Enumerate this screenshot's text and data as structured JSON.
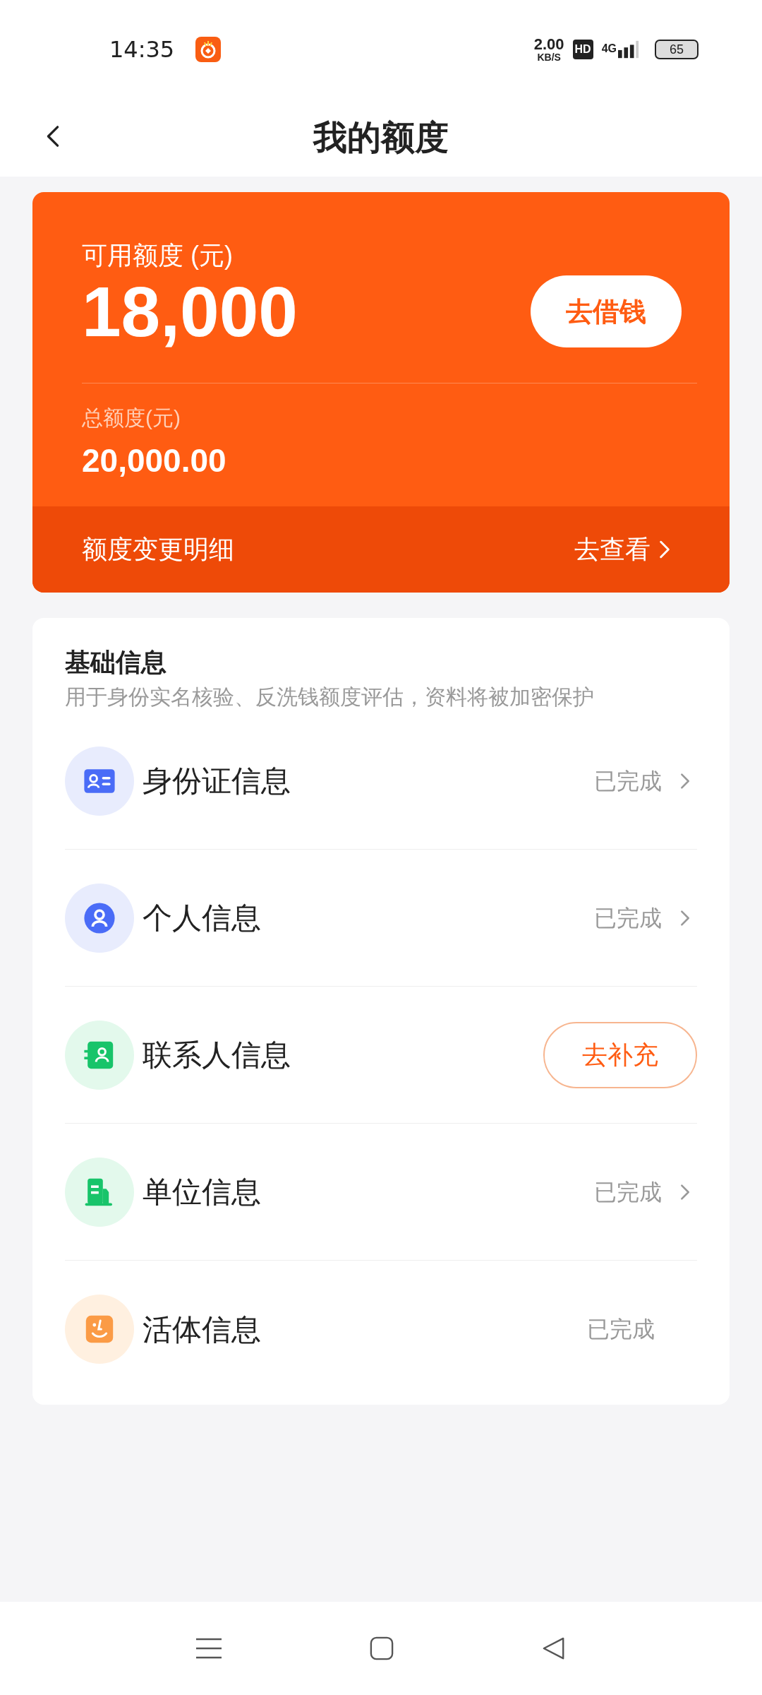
{
  "status_bar": {
    "time": "14:35",
    "speed_value": "2.00",
    "speed_unit": "KB/S",
    "hd": "HD",
    "network": "4G",
    "battery": "65"
  },
  "header": {
    "title": "我的额度"
  },
  "quota_card": {
    "available_label": "可用额度 (元)",
    "available_amount": "18,000",
    "borrow_button": "去借钱",
    "total_label": "总额度(元)",
    "total_amount": "20,000.00",
    "detail_label": "额度变更明细",
    "detail_link": "去查看"
  },
  "basic_info": {
    "title": "基础信息",
    "subtitle": "用于身份实名核验、反洗钱额度评估，资料将被加密保护",
    "items": [
      {
        "kind": "link",
        "label": "身份证信息",
        "status": "已完成"
      },
      {
        "kind": "link",
        "label": "个人信息",
        "status": "已完成"
      },
      {
        "kind": "action",
        "label": "联系人信息",
        "action": "去补充"
      },
      {
        "kind": "link",
        "label": "单位信息",
        "status": "已完成"
      },
      {
        "kind": "status",
        "label": "活体信息",
        "status": "已完成"
      }
    ]
  }
}
